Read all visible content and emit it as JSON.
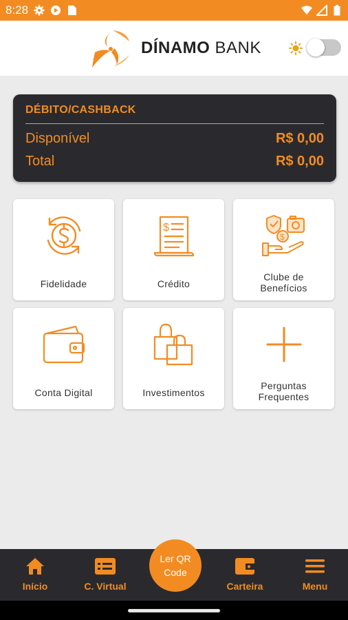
{
  "status_bar": {
    "time": "8:28"
  },
  "header": {
    "brand_bold": "DÍNAMO",
    "brand_light": "BANK"
  },
  "balance": {
    "title": "DÉBITO/CASHBACK",
    "rows": [
      {
        "label": "Disponível",
        "value": "R$ 0,00"
      },
      {
        "label": "Total",
        "value": "R$ 0,00"
      }
    ]
  },
  "tiles": [
    {
      "label": "Fidelidade",
      "icon": "dollar-cycle-icon"
    },
    {
      "label": "Crédito",
      "icon": "receipt-icon"
    },
    {
      "label": "Clube de\nBenefícios",
      "icon": "benefits-hand-icon"
    },
    {
      "label": "Conta Digital",
      "icon": "wallet-icon"
    },
    {
      "label": "Investimentos",
      "icon": "shopping-bags-icon"
    },
    {
      "label": "Perguntas\nFrequentes",
      "icon": "plus-icon"
    }
  ],
  "bottom_nav": {
    "items": [
      {
        "label": "Início",
        "icon": "home-icon"
      },
      {
        "label": "C. Virtual",
        "icon": "virtual-card-icon"
      },
      {
        "label": "Carteira",
        "icon": "wallet-icon"
      },
      {
        "label": "Menu",
        "icon": "hamburger-icon"
      }
    ],
    "qr_label": "Ler QR\nCode"
  },
  "colors": {
    "accent": "#f28c22",
    "dark": "#2a2a2e",
    "background": "#ebebeb"
  }
}
